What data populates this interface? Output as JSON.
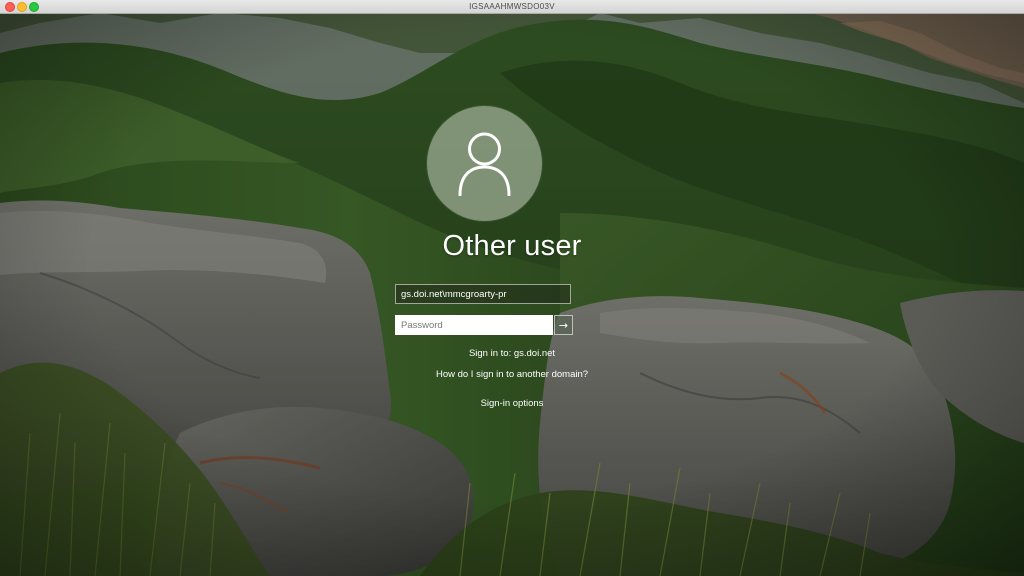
{
  "window": {
    "title": "IGSAAAHMWSDO03V"
  },
  "login": {
    "user_name": "Other user",
    "account_value": "gs.doi.net\\mmcgroarty-pr",
    "password_placeholder": "Password",
    "submit_glyph": "→",
    "sign_in_to": "Sign in to: gs.doi.net",
    "other_domain_link": "How do I sign in to another domain?",
    "sign_in_options_link": "Sign-in options"
  },
  "icons": {
    "avatar": "user-silhouette-icon",
    "submit": "arrow-right-icon"
  },
  "colors": {
    "text": "#ffffff",
    "avatar_bg": "#c8d2be",
    "close": "#ff5f57",
    "minimize": "#febc2e",
    "maximize": "#28c840"
  }
}
